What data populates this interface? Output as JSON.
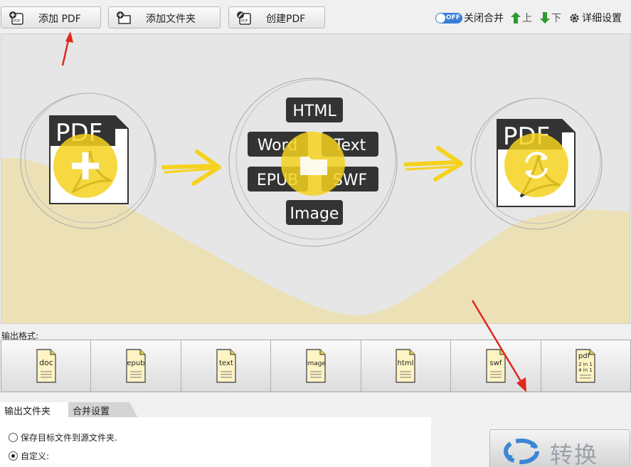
{
  "toolbar": {
    "add_pdf": "添加 PDF",
    "add_folder": "添加文件夹",
    "create_pdf": "创建PDF",
    "toggle_state": "OFF",
    "merge_label": "关闭合并",
    "up_label": "上",
    "down_label": "下",
    "settings_label": "详细设置"
  },
  "illustration": {
    "pdf_left": "PDF",
    "formats": [
      "HTML",
      "Word",
      "Text",
      "EPUB",
      "SWF",
      "Image"
    ],
    "pdf_right": "PDF"
  },
  "output_format": {
    "label": "输出格式:",
    "items": [
      "doc",
      "epub",
      "text",
      "image",
      "html",
      "swf",
      "pdf"
    ],
    "pdf_sub": [
      "2 in 1",
      "4 in 1"
    ]
  },
  "tabs": [
    "输出文件夹",
    "合并设置"
  ],
  "options": {
    "save_to_source": "保存目标文件到源文件夹.",
    "custom": "自定义:"
  },
  "convert_label": "转换",
  "colors": {
    "accent_yellow": "#f5d21f",
    "toggle_blue": "#3a7dd8",
    "arrow_red": "#e0271f",
    "label_dark": "#333333"
  }
}
